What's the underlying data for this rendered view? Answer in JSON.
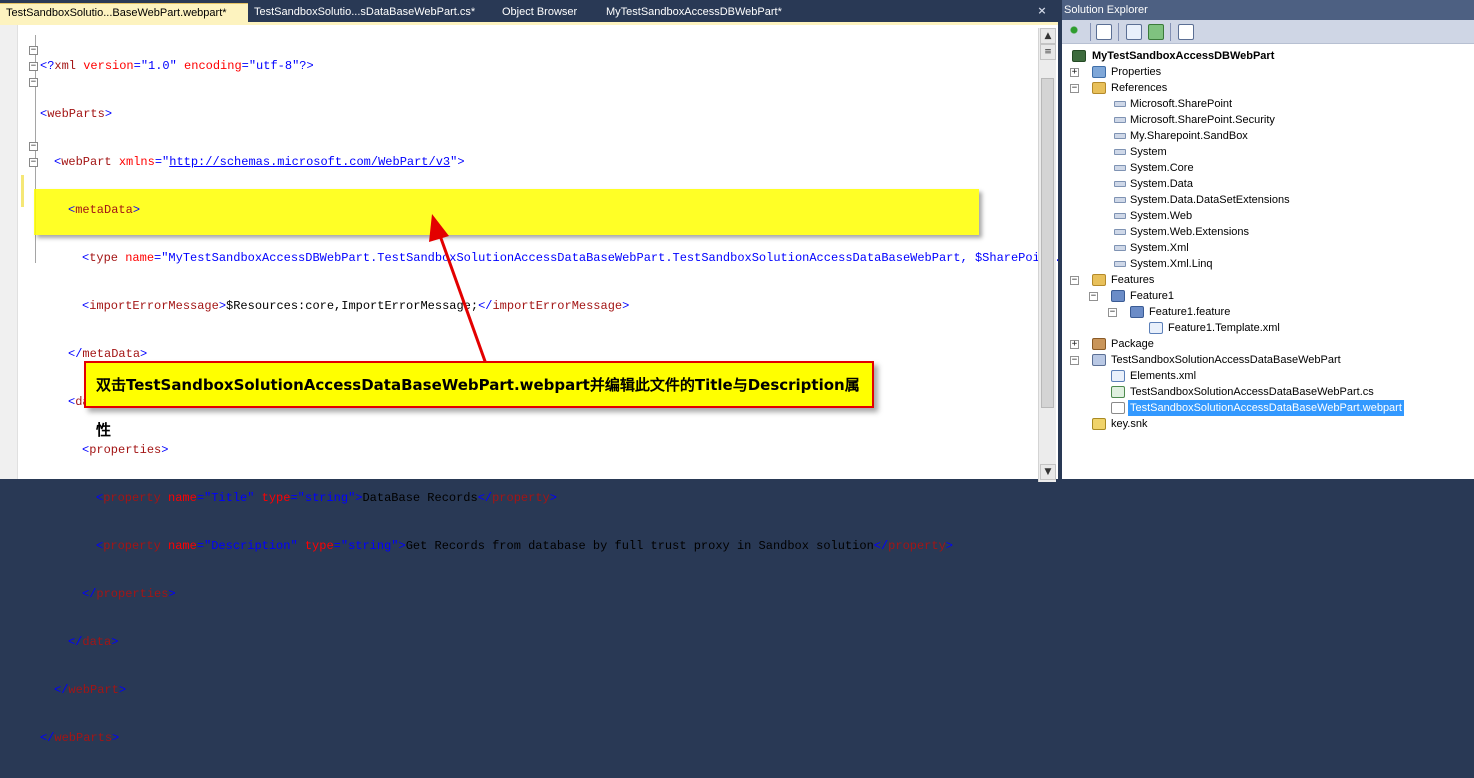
{
  "tabs": [
    {
      "label": "TestSandboxSolutio...BaseWebPart.webpart*",
      "active": true
    },
    {
      "label": "TestSandboxSolutio...sDataBaseWebPart.cs*",
      "active": false
    },
    {
      "label": "Object Browser",
      "active": false
    },
    {
      "label": "MyTestSandboxAccessDBWebPart*",
      "active": false
    }
  ],
  "tab_close": "×",
  "code": {
    "l1": {
      "a": "<?",
      "b": "xml",
      "c": " version",
      "d": "=",
      "e": "\"1.0\"",
      "f": " encoding",
      "g": "=",
      "h": "\"utf-8\"",
      "i": "?>"
    },
    "l2": {
      "a": "<",
      "b": "webParts",
      "c": ">"
    },
    "l3": {
      "a": "<",
      "b": "webPart",
      "c": " xmlns",
      "d": "=",
      "e": "\"",
      "f": "http://schemas.microsoft.com/WebPart/v3",
      "g": "\"",
      "h": ">"
    },
    "l4": {
      "a": "<",
      "b": "metaData",
      "c": ">"
    },
    "l5": {
      "a": "<",
      "b": "type",
      "c": " name",
      "d": "=",
      "e": "\"MyTestSandboxAccessDBWebPart.TestSandboxSolutionAccessDataBaseWebPart.TestSandboxSolutionAccessDataBaseWebPart, $SharePoint.P"
    },
    "l6": {
      "a": "<",
      "b": "importErrorMessage",
      "c": ">",
      "d": "$Resources:core,ImportErrorMessage;",
      "e": "</",
      "f": "importErrorMessage",
      "g": ">"
    },
    "l7": {
      "a": "</",
      "b": "metaData",
      "c": ">"
    },
    "l8": {
      "a": "<",
      "b": "data",
      "c": ">"
    },
    "l9": {
      "a": "<",
      "b": "properties",
      "c": ">"
    },
    "l10": {
      "a": "<",
      "b": "property",
      "c": " name",
      "d": "=",
      "e": "\"Title\"",
      "f": " type",
      "g": "=",
      "h": "\"string\"",
      "i": ">",
      "j": "DataBase Records",
      "k": "</",
      "l": "property",
      "m": ">"
    },
    "l11": {
      "a": "<",
      "b": "property",
      "c": " name",
      "d": "=",
      "e": "\"Description\"",
      "f": " type",
      "g": "=",
      "h": "\"string\"",
      "i": ">",
      "j": "Get Records from database by full trust proxy in Sandbox solution",
      "k": "</",
      "l": "property",
      "m": ">"
    },
    "l12": {
      "a": "</",
      "b": "properties",
      "c": ">"
    },
    "l13": {
      "a": "</",
      "b": "data",
      "c": ">"
    },
    "l14": {
      "a": "</",
      "b": "webPart",
      "c": ">"
    },
    "l15": {
      "a": "</",
      "b": "webParts",
      "c": ">"
    }
  },
  "annotation": "双击TestSandboxSolutionAccessDataBaseWebPart.webpart并编辑此文件的Title与Description属性",
  "colors": {
    "annotation_border": "#e30000",
    "highlight": "#ffff00",
    "arrow": "#e30000"
  },
  "solution_explorer": {
    "title": "Solution Explorer",
    "toolbar_icons": [
      "properties-icon",
      "show-all-files-icon",
      "refresh-icon",
      "view-code-icon",
      "view-designer-icon"
    ],
    "tree": {
      "project": "MyTestSandboxAccessDBWebPart",
      "properties": "Properties",
      "references": "References",
      "refs": [
        "Microsoft.SharePoint",
        "Microsoft.SharePoint.Security",
        "My.Sharepoint.SandBox",
        "System",
        "System.Core",
        "System.Data",
        "System.Data.DataSetExtensions",
        "System.Web",
        "System.Web.Extensions",
        "System.Xml",
        "System.Xml.Linq"
      ],
      "features": "Features",
      "feature1": "Feature1",
      "feature1_feature": "Feature1.feature",
      "feature1_template": "Feature1.Template.xml",
      "package": "Package",
      "webpart_folder": "TestSandboxSolutionAccessDataBaseWebPart",
      "elements": "Elements.xml",
      "cs_file": "TestSandboxSolutionAccessDataBaseWebPart.cs",
      "webpart_file": "TestSandboxSolutionAccessDataBaseWebPart.webpart",
      "key": "key.snk"
    },
    "expander_plus": "+",
    "expander_minus": "−"
  }
}
